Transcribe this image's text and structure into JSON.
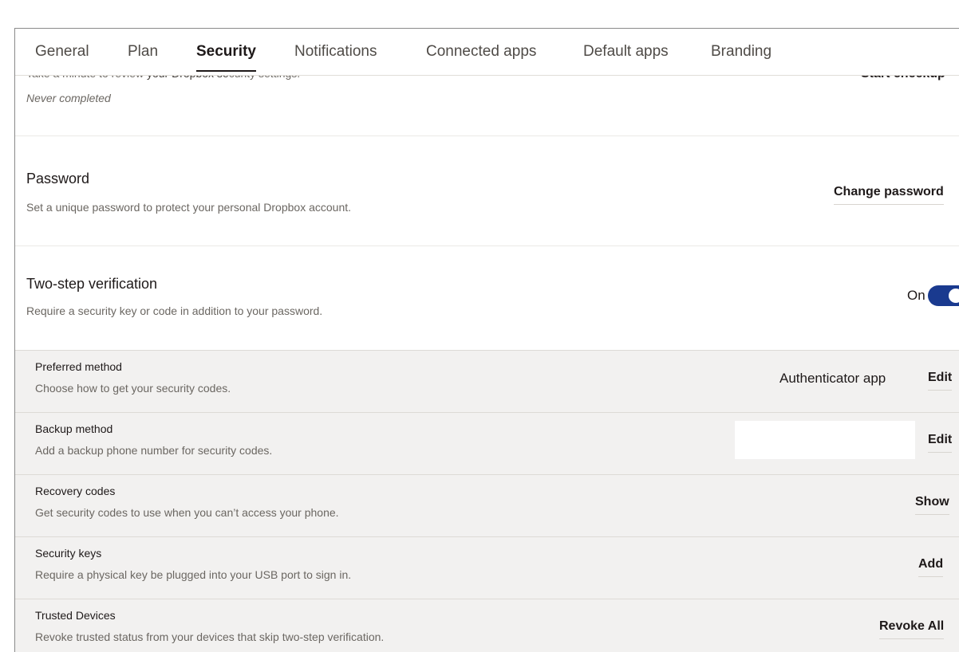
{
  "tabs": [
    {
      "label": "General"
    },
    {
      "label": "Plan"
    },
    {
      "label": "Security",
      "active": true
    },
    {
      "label": "Notifications"
    },
    {
      "label": "Connected apps"
    },
    {
      "label": "Default apps"
    },
    {
      "label": "Branding"
    }
  ],
  "checkup": {
    "text_start": "Take a minute to review ",
    "text_strike": "your Dropbox se",
    "text_end": "curity settings.",
    "status": "Never completed",
    "button": "Start checkup"
  },
  "password": {
    "title": "Password",
    "description": "Set a unique password to protect your personal Dropbox account.",
    "action": "Change password"
  },
  "two_step": {
    "title": "Two-step verification",
    "description": "Require a security key or code in addition to your password.",
    "toggle_label": "On",
    "toggle_on": true,
    "toggle_color": "#1a3a8f"
  },
  "sub_rows": [
    {
      "title": "Preferred method",
      "description": "Choose how to get your security codes.",
      "value": "Authenticator app",
      "action": "Edit"
    },
    {
      "title": "Backup method",
      "description": "Add a backup phone number for security codes.",
      "value": "",
      "action": "Edit"
    },
    {
      "title": "Recovery codes",
      "description": "Get security codes to use when you can’t access your phone.",
      "value": "",
      "action": "Show"
    },
    {
      "title": "Security keys",
      "description": "Require a physical key be plugged into your USB port to sign in.",
      "value": "",
      "action": "Add"
    },
    {
      "title": "Trusted Devices",
      "description": "Revoke trusted status from your devices that skip two-step verification.",
      "value": "",
      "action": "Revoke All"
    }
  ]
}
